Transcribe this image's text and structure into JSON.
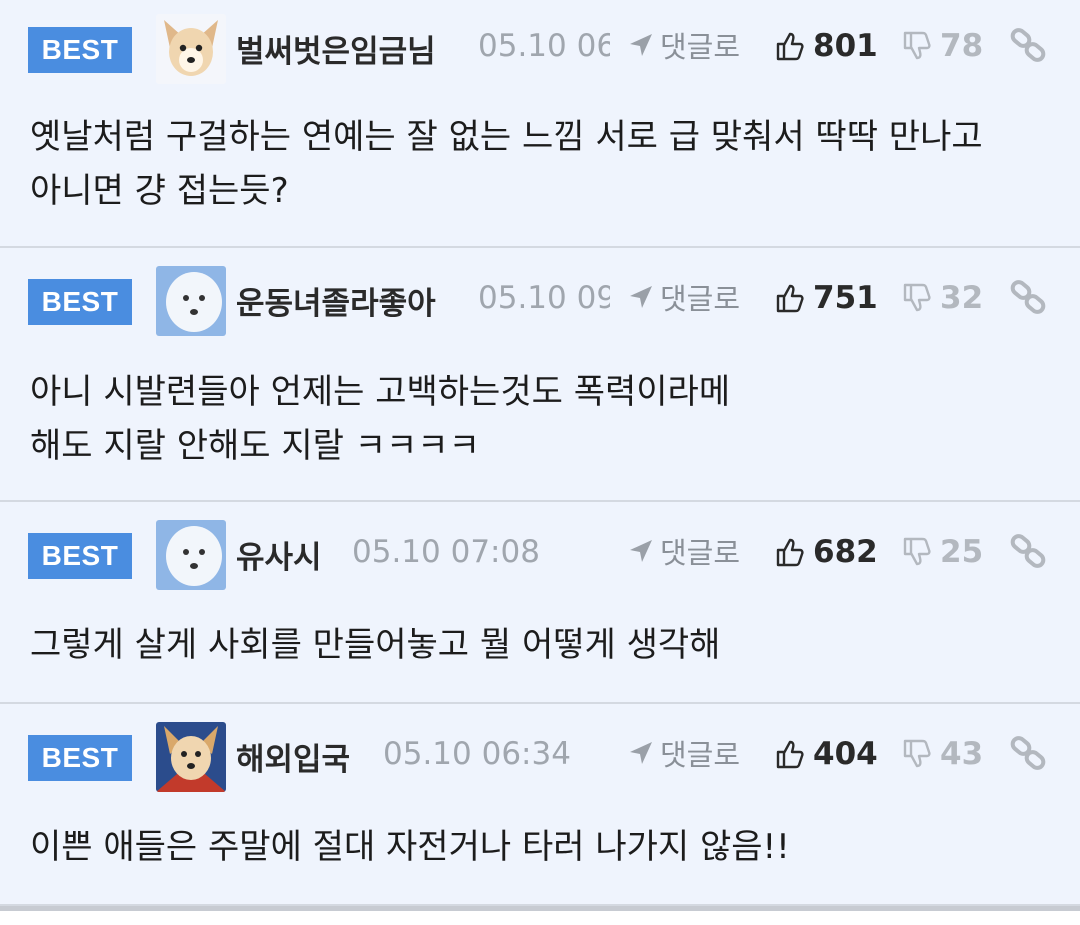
{
  "comments": [
    {
      "badge": "BEST",
      "nickname": "벌써벗은임금님",
      "time": "05.10 06",
      "reply_label": "댓글로",
      "likes": "801",
      "dislikes": "78",
      "avatar_icon": "dog-avatar-icon",
      "text": [
        "옛날처럼 구걸하는 연예는 잘 없는 느낌 서로 급 맞춰서 딱딱 만나고",
        "아니면 걍 접는듯?"
      ]
    },
    {
      "badge": "BEST",
      "nickname": "운동녀졸라좋아",
      "time": "05.10 09",
      "reply_label": "댓글로",
      "likes": "751",
      "dislikes": "32",
      "avatar_icon": "white-dog-avatar-icon",
      "text": [
        "아니 시발련들아 언제는 고백하는것도 폭력이라메",
        "해도 지랄 안해도 지랄 ㅋㅋㅋㅋ"
      ]
    },
    {
      "badge": "BEST",
      "nickname": "유사시",
      "time": "05.10 07:08",
      "reply_label": "댓글로",
      "likes": "682",
      "dislikes": "25",
      "avatar_icon": "white-dog-avatar-icon",
      "text": [
        "그렇게 살게 사회를 만들어놓고 뭘 어떻게 생각해"
      ]
    },
    {
      "badge": "BEST",
      "nickname": "해외입국",
      "time": "05.10 06:34",
      "reply_label": "댓글로",
      "likes": "404",
      "dislikes": "43",
      "avatar_icon": "dog-avatar-icon",
      "text": [
        "이쁜 애들은 주말에 절대 자전거나 타러 나가지 않음!!"
      ]
    }
  ],
  "colors": {
    "background": "#eff4fd",
    "badge": "#4a8de0",
    "divider": "#d4d9e1",
    "muted": "#a0a6ae"
  }
}
